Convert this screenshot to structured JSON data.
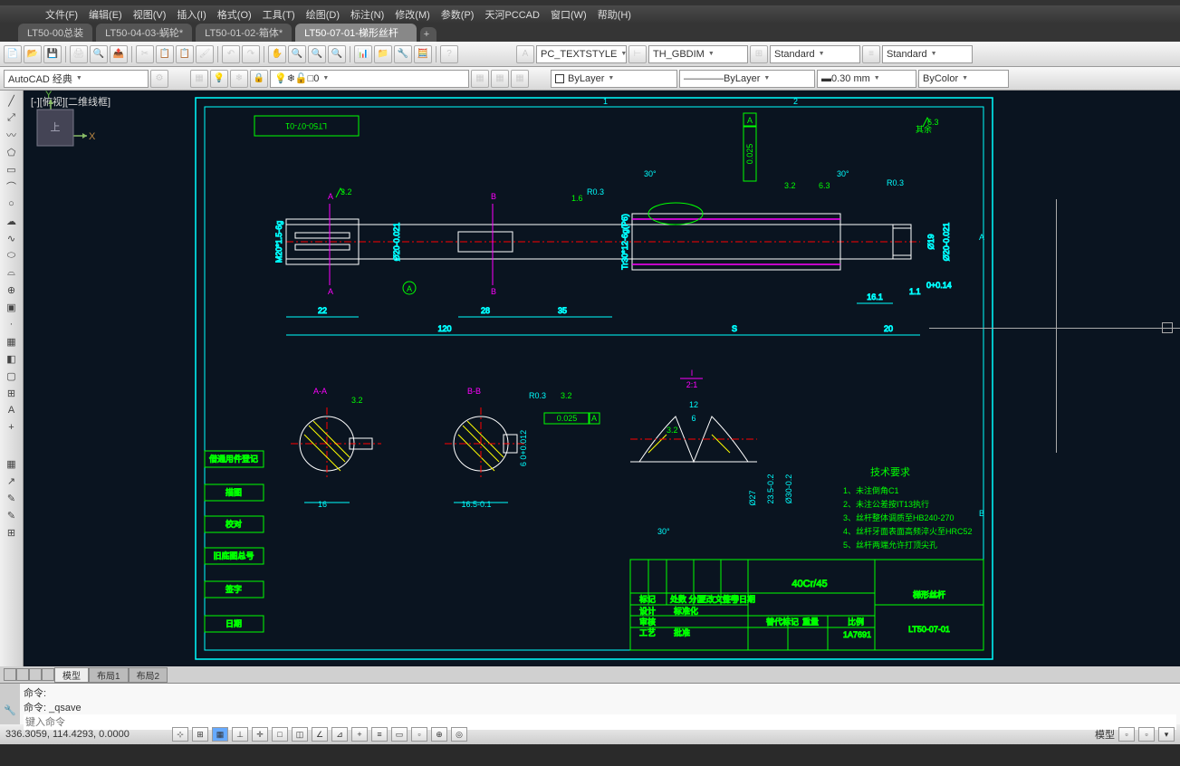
{
  "title": "AutoCAD 经典",
  "menubar": [
    "文件(F)",
    "编辑(E)",
    "视图(V)",
    "插入(I)",
    "格式(O)",
    "工具(T)",
    "绘图(D)",
    "标注(N)",
    "修改(M)",
    "参数(P)",
    "天河PCCAD",
    "窗口(W)",
    "帮助(H)"
  ],
  "tabs": [
    {
      "label": "LT50-00总装",
      "active": false
    },
    {
      "label": "LT50-04-03-蜗轮*",
      "active": false
    },
    {
      "label": "LT50-01-02-箱体*",
      "active": false
    },
    {
      "label": "LT50-07-01-梯形丝杆",
      "active": true
    }
  ],
  "toolbar1": {
    "textstyle": "PC_TEXTSTYLE",
    "dimstyle": "TH_GBDIM",
    "tablestyle": "Standard",
    "standard": "Standard"
  },
  "toolbar2": {
    "workspace": "AutoCAD 经典",
    "layer": "0",
    "bylayer1": "ByLayer",
    "bylayer2": "ByLayer",
    "lineweight": "0.30 mm",
    "bycolor": "ByColor"
  },
  "viewlabel": "[-][俯视][二维线框]",
  "layout_tabs": [
    "模型",
    "布局1",
    "布局2"
  ],
  "command": {
    "line1": "命令:",
    "line2": "命令: _qsave",
    "prompt": "键入命令"
  },
  "status": {
    "coords": "336.3059, 114.4293, 0.0000",
    "model_label": "模型"
  },
  "drawing_data": {
    "part_number": "LT50-07-01",
    "part_name": "梯形丝杆",
    "material": "40Cr/45",
    "tech_req_title": "技术要求",
    "tech_req": [
      "1、未注倒角C1",
      "2、未注公差按IT13执行",
      "3、丝杆整体调质至HB240-270",
      "4、丝杆牙面表面高频淬火至HRC52",
      "5、丝杆两端允许打顶尖孔"
    ],
    "main_dims": {
      "length_total": "120",
      "length_22": "22",
      "length_28": "28",
      "length_35": "35",
      "length_S": "S",
      "length_20": "20",
      "length_16_1": "16.1",
      "length_1_1": "1.1",
      "tol_0_14": "0+0.14",
      "dia_20": "Ø20-0.021",
      "thread_m20": "M20*1.5-6g",
      "thread_tr30": "Tr30*12-6g(P6)",
      "dia_19": "Ø19",
      "dia_20_2": "Ø20-0.021",
      "r03": "R0.3",
      "r03_2": "R0.3",
      "angle_30": "30°",
      "angle_30_2": "30°",
      "chamfer_1_6": "1.6",
      "surf_3_2": "3.2",
      "surf_6_3": "6.3",
      "surf_6_3_top": "6.3",
      "gtol_0_025": "0.025",
      "datum_a": "A"
    },
    "section_aa": {
      "label": "A-A",
      "width_16": "16",
      "surf_3_2": "3.2"
    },
    "section_bb": {
      "label": "B-B",
      "dim_16_5": "16.5-0.1",
      "dim_6": "6 0+0.012",
      "r03": "R0.3",
      "gtol": "0.025",
      "surf_3_2": "3.2"
    },
    "detail_i": {
      "label": "I",
      "scale": "2:1",
      "dim_12": "12",
      "dim_6": "6",
      "dim_23_5": "23.5-0.2",
      "dim_30": "Ø30-0.2",
      "dia_27": "Ø27",
      "angle_30": "30°",
      "surf_3_2": "3.2"
    },
    "title_block": {
      "借通用件登记": "借通用件登记",
      "描图": "描图",
      "校对": "校对",
      "旧底图总号": "旧底图总号",
      "签字": "签字",
      "日期": "日期",
      "设计": "设计",
      "标准化": "标准化",
      "审核": "审核",
      "工艺": "工艺",
      "批准": "批准",
      "替代标记": "替代标记",
      "重量": "重量",
      "比例": "比例",
      "num": "1A7691"
    }
  }
}
